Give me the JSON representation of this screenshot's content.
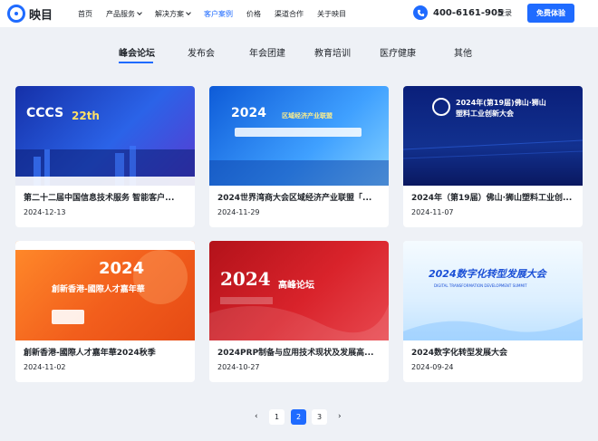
{
  "brand": {
    "name": "映目"
  },
  "nav": {
    "items": [
      {
        "label": "首页",
        "dropdown": false,
        "active": false
      },
      {
        "label": "产品服务",
        "dropdown": true,
        "active": false
      },
      {
        "label": "解决方案",
        "dropdown": true,
        "active": false
      },
      {
        "label": "客户案例",
        "dropdown": false,
        "active": true
      },
      {
        "label": "价格",
        "dropdown": false,
        "active": false
      },
      {
        "label": "渠道合作",
        "dropdown": false,
        "active": false
      },
      {
        "label": "关于映目",
        "dropdown": false,
        "active": false
      }
    ],
    "phone": "400-6161-905",
    "login": "登录",
    "trial": "免费体验"
  },
  "tabs": [
    {
      "label": "峰会论坛",
      "active": true
    },
    {
      "label": "发布会",
      "active": false
    },
    {
      "label": "年会团建",
      "active": false
    },
    {
      "label": "教育培训",
      "active": false
    },
    {
      "label": "医疗健康",
      "active": false
    },
    {
      "label": "其他",
      "active": false
    }
  ],
  "cases": [
    {
      "title": "第二十二届中国信息技术服务 智能客户...",
      "date": "2024-12-13",
      "image_text": "CCCS",
      "image_badge": "22th"
    },
    {
      "title": "2024世界湾商大会区域经济产业联盟「...",
      "date": "2024-11-29",
      "image_text": "2024",
      "image_badge": "区域经济产业联盟"
    },
    {
      "title": "2024年（第19届）佛山·狮山塑料工业创...",
      "date": "2024-11-07",
      "image_text": "2024年(第19届)佛山·狮山",
      "image_badge": "塑料工业创新大会"
    },
    {
      "title": "創新香港-國際人才嘉年華2024秋季",
      "date": "2024-11-02",
      "image_text": "2024",
      "image_badge": "創新香港-國際人才嘉年華"
    },
    {
      "title": "2024PRP制备与应用技术现状及发展高...",
      "date": "2024-10-27",
      "image_text": "2024",
      "image_badge": "高峰论坛"
    },
    {
      "title": "2024数字化转型发展大会",
      "date": "2024-09-24",
      "image_text": "2024数字化转型发展大会",
      "image_badge": "DIGITAL TRANSFORMATION DEVELOPMENT SUMMIT"
    }
  ],
  "pagination": {
    "pages": [
      "1",
      "2",
      "3"
    ],
    "current": "2",
    "prev": "‹",
    "next": "›"
  },
  "colors": {
    "accent": "#1f6bff",
    "background": "#eef1f6"
  },
  "icons": {
    "logo": "logo-icon",
    "phone": "phone-icon",
    "prev": "chevron-left-icon",
    "next": "chevron-right-icon"
  }
}
